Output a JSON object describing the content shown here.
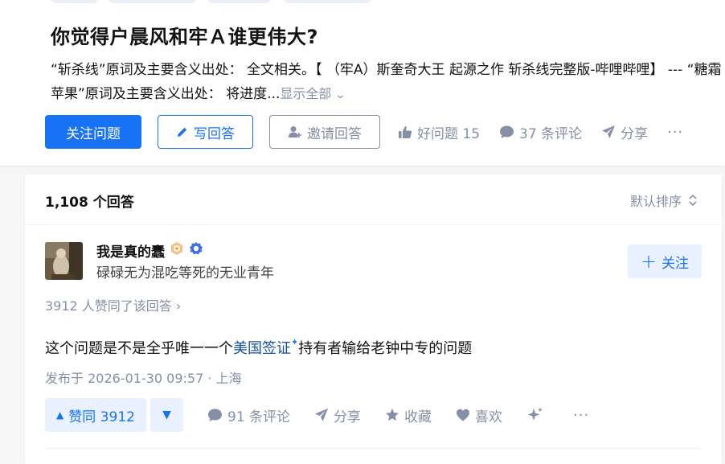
{
  "question": {
    "title": "你觉得户晨风和牢Ａ谁更伟大?",
    "detail": "“斩杀线”原词及主要含义出处： 全文相关。【 （牢A）斯奎奇大王 起源之作 斩杀线完整版-哔哩哔哩】 --- “糖霜苹果”原词及主要含义出处： 将进度...",
    "show_all": "显示全部"
  },
  "question_actions": {
    "follow": "关注问题",
    "write": "写回答",
    "invite": "邀请回答",
    "good_question": "好问题 15",
    "comments": "37 条评论",
    "share": "分享",
    "more": "···"
  },
  "answers_header": {
    "count": "1,108 个回答",
    "sort": "默认排序"
  },
  "answer": {
    "author_name": "我是真的蠢",
    "author_bio": "碌碌无为混吃等死的无业青年",
    "follow": "关注",
    "voters": "3912 人赞同了该回答 ›",
    "content_before": "这个问题是不是全乎唯一一个",
    "content_link": "美国签证",
    "content_spark": "✦",
    "content_after": "持有者输给老钟中专的问题",
    "meta": "发布于 2026-01-30 09:57 · 上海",
    "upvote": "赞同 3912",
    "comments": "91 条评论",
    "share": "分享",
    "collect": "收藏",
    "like": "喜欢",
    "more": "···"
  },
  "colors": {
    "primary": "#1772f6",
    "muted": "#8590a6",
    "link": "#175199",
    "vote_bg": "#e8f1fd"
  },
  "icons": [
    "pencil-icon",
    "invite-user-icon",
    "thumbs-up-icon",
    "comment-icon",
    "share-icon",
    "sort-icon",
    "verified-badge-icon",
    "level-badge-icon",
    "star-icon",
    "heart-icon",
    "sparkle-icon"
  ]
}
